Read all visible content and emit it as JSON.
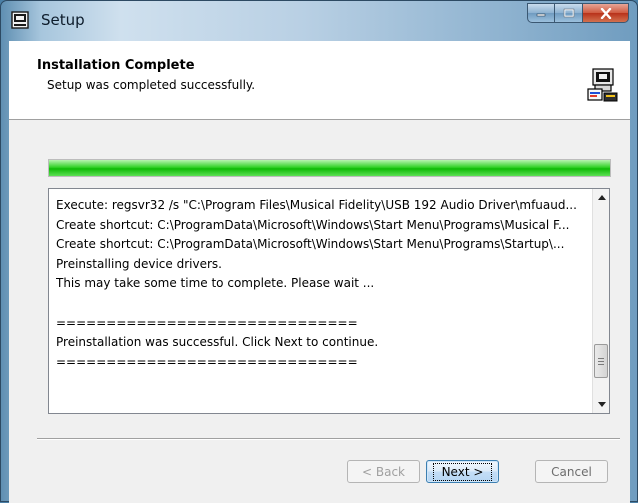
{
  "window": {
    "title": "Setup"
  },
  "header": {
    "title": "Installation Complete",
    "subtitle": "Setup was completed successfully."
  },
  "progress": {
    "value_percent": 100,
    "color": "#1ec814"
  },
  "log": {
    "lines": [
      "Execute: regsvr32 /s \"C:\\Program Files\\Musical Fidelity\\USB 192 Audio Driver\\mfuaud...",
      "Create shortcut: C:\\ProgramData\\Microsoft\\Windows\\Start Menu\\Programs\\Musical F...",
      "Create shortcut: C:\\ProgramData\\Microsoft\\Windows\\Start Menu\\Programs\\Startup\\...",
      "Preinstalling device drivers.",
      "This may take some time to complete. Please wait ...",
      "",
      "==============================",
      "Preinstallation was successful. Click Next to continue.",
      "=============================="
    ]
  },
  "buttons": {
    "back_label": "< Back",
    "next_label": "Next >",
    "cancel_label": "Cancel"
  }
}
